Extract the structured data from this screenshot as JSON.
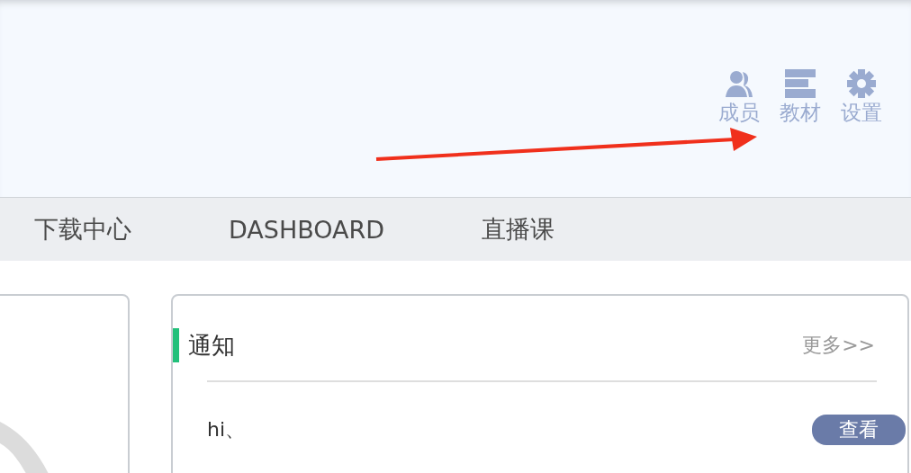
{
  "toolbar": {
    "items": [
      {
        "kind": "members",
        "label": "成员"
      },
      {
        "kind": "materials",
        "label": "教材"
      },
      {
        "kind": "settings",
        "label": "设置"
      }
    ]
  },
  "nav": {
    "items": [
      {
        "label": "下载中心"
      },
      {
        "label": "DASHBOARD"
      },
      {
        "label": "直播课"
      }
    ]
  },
  "notice_panel": {
    "title": "通知",
    "more_link": "更多>>",
    "items": [
      {
        "text": "hi、",
        "button": "查看"
      }
    ]
  }
}
